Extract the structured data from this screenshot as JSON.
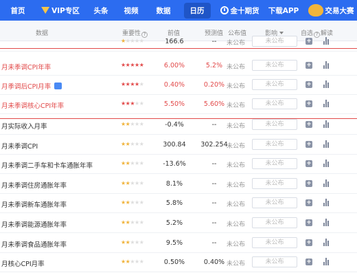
{
  "nav": {
    "items": [
      {
        "label": "首页",
        "icon": "",
        "active": false
      },
      {
        "label": "VIP专区",
        "icon": "vip-icon",
        "active": false
      },
      {
        "label": "头条",
        "icon": "",
        "active": false
      },
      {
        "label": "视频",
        "icon": "",
        "active": false
      },
      {
        "label": "数据",
        "icon": "",
        "active": false
      },
      {
        "label": "日历",
        "icon": "",
        "active": true
      },
      {
        "label": "金十期货",
        "icon": "futures-icon",
        "active": false
      },
      {
        "label": "下载APP",
        "icon": "",
        "active": false
      },
      {
        "label": "交易大赛",
        "icon": "contest-icon",
        "active": false
      }
    ]
  },
  "table": {
    "headers": {
      "data": "数据",
      "importance": "重要性",
      "previous": "前值",
      "forecast": "预测值",
      "published": "公布值",
      "impact": "影响",
      "custom": "自选",
      "interpret": "解读"
    },
    "rows": [
      {
        "name": "",
        "stars": 1,
        "previous": "166.6",
        "forecast": "--",
        "published": "未公布",
        "impact": "未公布",
        "highlight": false,
        "badge": false
      },
      {
        "name": "月未季调CPI年率",
        "stars": 5,
        "previous": "6.00%",
        "forecast": "5.2%",
        "published": "未公布",
        "impact": "未公布",
        "highlight": true,
        "badge": false
      },
      {
        "name": "月季调后CPI月率",
        "stars": 4,
        "previous": "0.40%",
        "forecast": "0.20%",
        "published": "未公布",
        "impact": "未公布",
        "highlight": true,
        "badge": true
      },
      {
        "name": "月未季调核心CPI年率",
        "stars": 3,
        "previous": "5.50%",
        "forecast": "5.60%",
        "published": "未公布",
        "impact": "未公布",
        "highlight": true,
        "badge": false
      },
      {
        "name": "月实际收入月率",
        "stars": 2,
        "previous": "-0.4%",
        "forecast": "--",
        "published": "未公布",
        "impact": "未公布",
        "highlight": false,
        "badge": false
      },
      {
        "name": "月未季调CPI",
        "stars": 2,
        "previous": "300.84",
        "forecast": "302.254",
        "published": "未公布",
        "impact": "未公布",
        "highlight": false,
        "badge": false
      },
      {
        "name": "月未季调二手车和卡车通胀年率",
        "stars": 2,
        "previous": "-13.6%",
        "forecast": "--",
        "published": "未公布",
        "impact": "未公布",
        "highlight": false,
        "badge": false
      },
      {
        "name": "月未季调住房通胀年率",
        "stars": 2,
        "previous": "8.1%",
        "forecast": "--",
        "published": "未公布",
        "impact": "未公布",
        "highlight": false,
        "badge": false
      },
      {
        "name": "月未季调新车通胀年率",
        "stars": 2,
        "previous": "5.8%",
        "forecast": "--",
        "published": "未公布",
        "impact": "未公布",
        "highlight": false,
        "badge": false
      },
      {
        "name": "月未季调能源通胀年率",
        "stars": 2,
        "previous": "5.2%",
        "forecast": "--",
        "published": "未公布",
        "impact": "未公布",
        "highlight": false,
        "badge": false
      },
      {
        "name": "月未季调食品通胀年率",
        "stars": 2,
        "previous": "9.5%",
        "forecast": "--",
        "published": "未公布",
        "impact": "未公布",
        "highlight": false,
        "badge": false
      },
      {
        "name": "月核心CPI月率",
        "stars": 2,
        "previous": "0.50%",
        "forecast": "0.40%",
        "published": "未公布",
        "impact": "未公布",
        "highlight": false,
        "badge": false
      }
    ]
  },
  "colors": {
    "nav_bg": "#2c6cf0",
    "highlight_red": "#e24a4a",
    "star_gold": "#f0b33a"
  }
}
